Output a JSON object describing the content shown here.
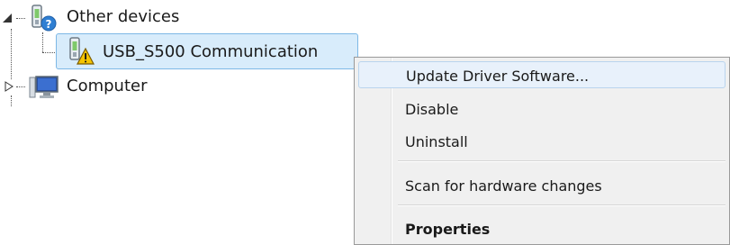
{
  "tree": {
    "other_devices": {
      "label": "Other devices",
      "icon": "unknown-device-icon",
      "expanded": true
    },
    "usb_device": {
      "label": "USB_S500 Communication",
      "icon": "warning-device-icon",
      "selected": true
    },
    "computer": {
      "label": "Computer",
      "icon": "computer-monitor-icon",
      "expanded": false
    }
  },
  "context_menu": {
    "items": [
      {
        "label": "Update Driver Software...",
        "highlighted": true
      },
      {
        "label": "Disable"
      },
      {
        "label": "Uninstall"
      },
      {
        "label": "Scan for hardware changes"
      },
      {
        "label": "Properties",
        "bold": true
      }
    ]
  },
  "colors": {
    "selection": "#d8ecfb",
    "selection_border": "#7db8e6",
    "menu_bg": "#f0f0f0",
    "warning": "#f5c400"
  }
}
